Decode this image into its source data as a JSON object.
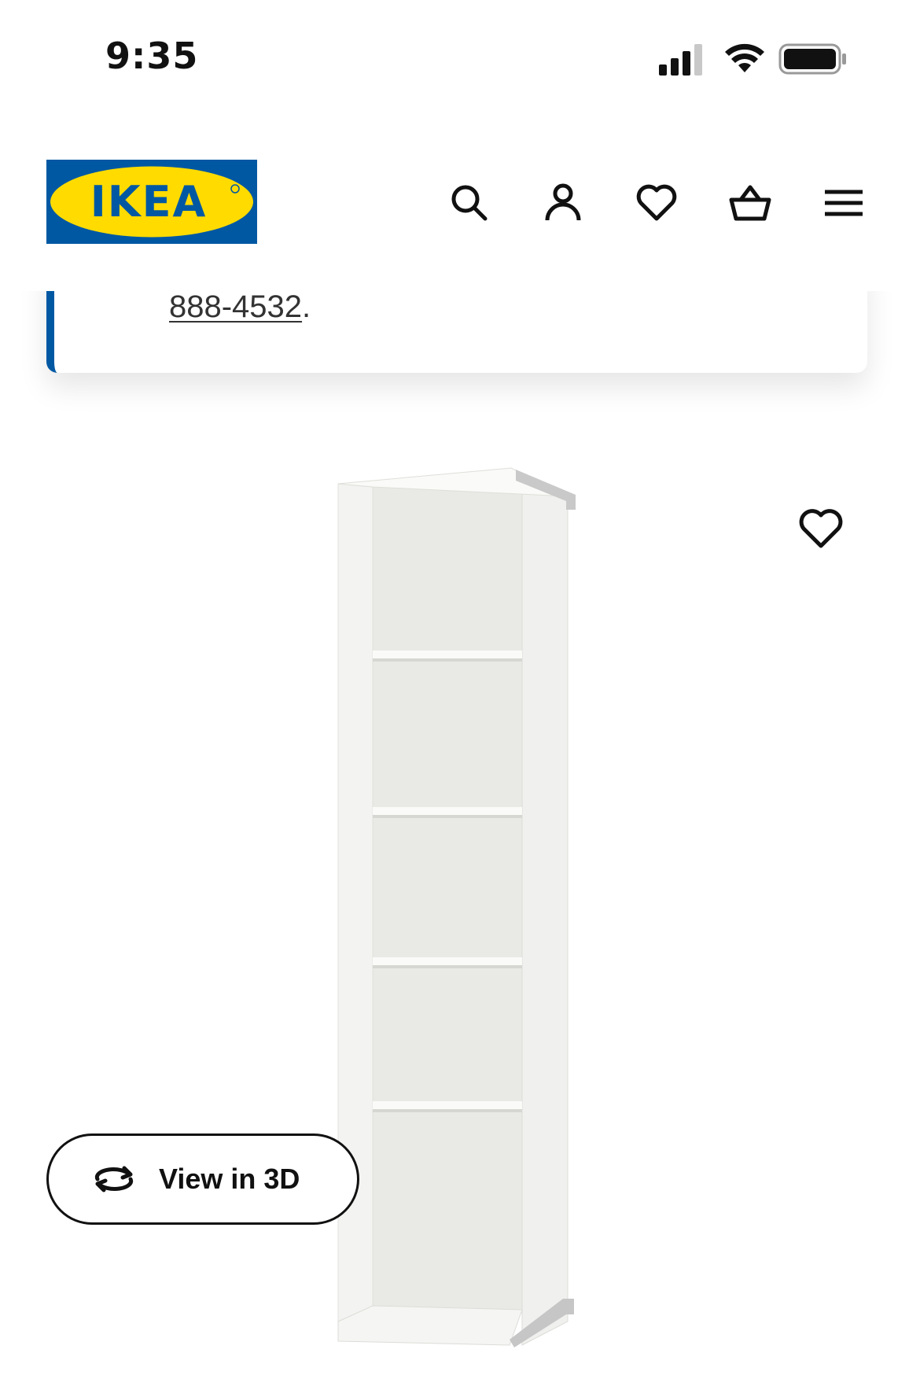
{
  "status_bar": {
    "time": "9:35",
    "icons": [
      "cellular-signal-icon",
      "wifi-icon",
      "battery-icon"
    ]
  },
  "header": {
    "logo_text": "IKEA",
    "logo_colors": {
      "blue": "#0058a3",
      "yellow": "#ffdb00"
    },
    "nav_icons": [
      "search-icon",
      "account-icon",
      "heart-icon",
      "basket-icon",
      "menu-icon"
    ]
  },
  "notice": {
    "phone_link": "888-4532",
    "phone_suffix": ".",
    "accent_color": "#0058a3"
  },
  "product": {
    "image_alt": "white bookcase with shelves",
    "favorite_icon": "heart-icon",
    "view_3d_label": "View in 3D",
    "view_3d_icon": "rotate-3d-icon"
  }
}
